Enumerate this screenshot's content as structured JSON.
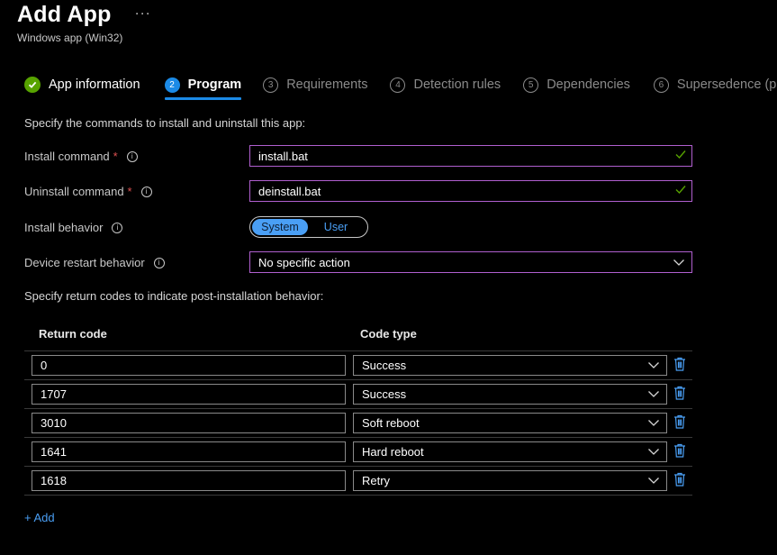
{
  "header": {
    "title": "Add App",
    "more": "···",
    "subtitle": "Windows app (Win32)"
  },
  "steps": [
    {
      "num": "",
      "label": "App information",
      "state": "done"
    },
    {
      "num": "2",
      "label": "Program",
      "state": "active"
    },
    {
      "num": "3",
      "label": "Requirements",
      "state": "todo"
    },
    {
      "num": "4",
      "label": "Detection rules",
      "state": "todo"
    },
    {
      "num": "5",
      "label": "Dependencies",
      "state": "todo"
    },
    {
      "num": "6",
      "label": "Supersedence (prev",
      "state": "todo"
    }
  ],
  "intro": "Specify the commands to install and uninstall this app:",
  "form": {
    "install_label": "Install command",
    "install_required": "*",
    "install_value": "install.bat",
    "uninstall_label": "Uninstall command",
    "uninstall_required": "*",
    "uninstall_value": "deinstall.bat",
    "behavior_label": "Install behavior",
    "behavior_system": "System",
    "behavior_user": "User",
    "restart_label": "Device restart behavior",
    "restart_value": "No specific action",
    "info_glyph": "i"
  },
  "return_codes_intro": "Specify return codes to indicate post-installation behavior:",
  "table": {
    "col_return": "Return code",
    "col_type": "Code type",
    "rows": [
      {
        "code": "0",
        "type": "Success"
      },
      {
        "code": "1707",
        "type": "Success"
      },
      {
        "code": "3010",
        "type": "Soft reboot"
      },
      {
        "code": "1641",
        "type": "Hard reboot"
      },
      {
        "code": "1618",
        "type": "Retry"
      }
    ]
  },
  "add_link": "+ Add",
  "colors": {
    "accent": "#4a9ff5",
    "done": "#57a300",
    "active_step": "#1b8ae6",
    "valid_border": "#b05fcf",
    "required": "#e05252"
  }
}
